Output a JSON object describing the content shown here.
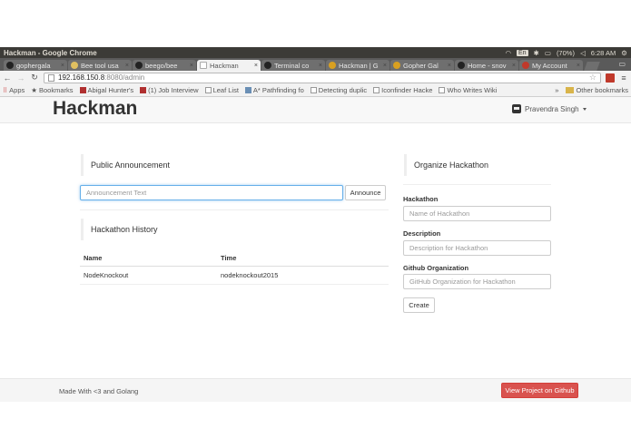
{
  "os": {
    "window_title": "Hackman - Google Chrome",
    "lang": "En",
    "battery": "(70%)",
    "time": "6:28 AM"
  },
  "tabs": [
    {
      "label": "gophergala",
      "active": false
    },
    {
      "label": "Bee tool usa",
      "active": false
    },
    {
      "label": "beego/bee",
      "active": false
    },
    {
      "label": "Hackman",
      "active": true
    },
    {
      "label": "Terminal co",
      "active": false
    },
    {
      "label": "Hackman | G",
      "active": false
    },
    {
      "label": "Gopher Gal",
      "active": false
    },
    {
      "label": "Home - snov",
      "active": false
    },
    {
      "label": "My Account",
      "active": false
    }
  ],
  "address": {
    "host": "192.168.150.8",
    "path": ":8080/admin"
  },
  "bookmarks": {
    "apps": "Apps",
    "items": [
      "Bookmarks",
      "Abigal Hunter's",
      "(1) Job Interview",
      "Leaf List",
      "A* Pathfinding fo",
      "Detecting duplic",
      "Iconfinder Hacke",
      "Who Writes Wiki"
    ],
    "more": "»",
    "other": "Other bookmarks"
  },
  "navbar": {
    "brand": "Hackman",
    "user": "Pravendra Singh"
  },
  "announcement": {
    "heading": "Public Announcement",
    "placeholder": "Announcement Text",
    "button": "Announce"
  },
  "history": {
    "heading": "Hackathon History",
    "columns": [
      "Name",
      "Time"
    ],
    "rows": [
      [
        "NodeKnockout",
        "nodeknockout2015"
      ]
    ]
  },
  "organize": {
    "heading": "Organize Hackathon",
    "fields": [
      {
        "label": "Hackathon",
        "placeholder": "Name of Hackathon"
      },
      {
        "label": "Description",
        "placeholder": "Description for Hackathon"
      },
      {
        "label": "Github Organization",
        "placeholder": "GitHub Organization for Hackathon"
      }
    ],
    "button": "Create"
  },
  "footer": {
    "text": "Made With <3 and Golang",
    "button": "View Project on Github"
  },
  "colors": {
    "danger": "#d9534f",
    "focus": "#66afe9",
    "navbar_bg": "#f8f8f8"
  }
}
